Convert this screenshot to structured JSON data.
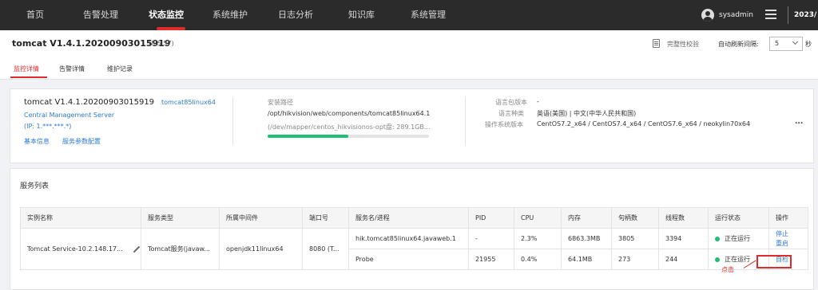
{
  "nav": {
    "items": [
      "首页",
      "告警处理",
      "状态监控",
      "系统维护",
      "日志分析",
      "知识库",
      "系统管理"
    ],
    "active": "状态监控",
    "username": "sysadmin",
    "datetime": "2023/"
  },
  "header": {
    "title": "tomcat V1.4.1.20200903015919",
    "version": "(8.5.57)",
    "integrity_label": "完整性校验",
    "refresh_label": "自动刷新间隔:",
    "refresh_value": "5",
    "refresh_unit": "秒",
    "tabs": [
      "监控详情",
      "告警详情",
      "维护记录"
    ],
    "active_tab": "监控详情"
  },
  "info": {
    "name": "tomcat V1.4.1.20200903015919",
    "tag": "tomcat85linux64",
    "server": "Central Management Server",
    "ip": "(IP: 1.***.***.*)",
    "link_basic": "基本信息",
    "link_params": "服务参数配置",
    "install_label": "安装路径",
    "install_path": "/opt/hikvision/web/components/tomcat85linux64.1",
    "disk": "(/dev/mapper/centos_hikvisionos-opt盘: 289.1GB...",
    "disk_usage_fraction": 0.5,
    "lang_pack_label": "语言包版本",
    "lang_pack_value": "-",
    "lang_label": "语言种类",
    "lang_value": "英语(美国) | 中文(中华人民共和国)",
    "os_label": "操作系统版本",
    "os_value": "CentOS7.2_x64 / CentOS7.4_x64 / CentOS7.6_x64 / neokylin70x64",
    "more": "..."
  },
  "services": {
    "title": "服务列表",
    "columns": [
      "实例名称",
      "服务类型",
      "所属中间件",
      "端口号",
      "服务名/进程",
      "PID",
      "CPU",
      "内存",
      "句柄数",
      "线程数",
      "运行状态",
      "操作"
    ],
    "instance": "Tomcat Service-10.2.148.17...",
    "type": "Tomcat服务(javaw...",
    "middleware": "openjdk11linux64",
    "port": "8080 (T...",
    "rows": [
      {
        "process": "hik.tomcat85linux64.javaweb.1",
        "pid": "-",
        "cpu": "2.3%",
        "mem": "6863.3MB",
        "handles": "3805",
        "threads": "3394",
        "status": "正在运行",
        "actions": [
          "停止",
          "重启"
        ]
      },
      {
        "process": "Probe",
        "pid": "21955",
        "cpu": "0.4%",
        "mem": "64.1MB",
        "handles": "273",
        "threads": "244",
        "status": "正在运行",
        "actions": [
          "自检"
        ]
      }
    ],
    "annotation": "点击"
  }
}
